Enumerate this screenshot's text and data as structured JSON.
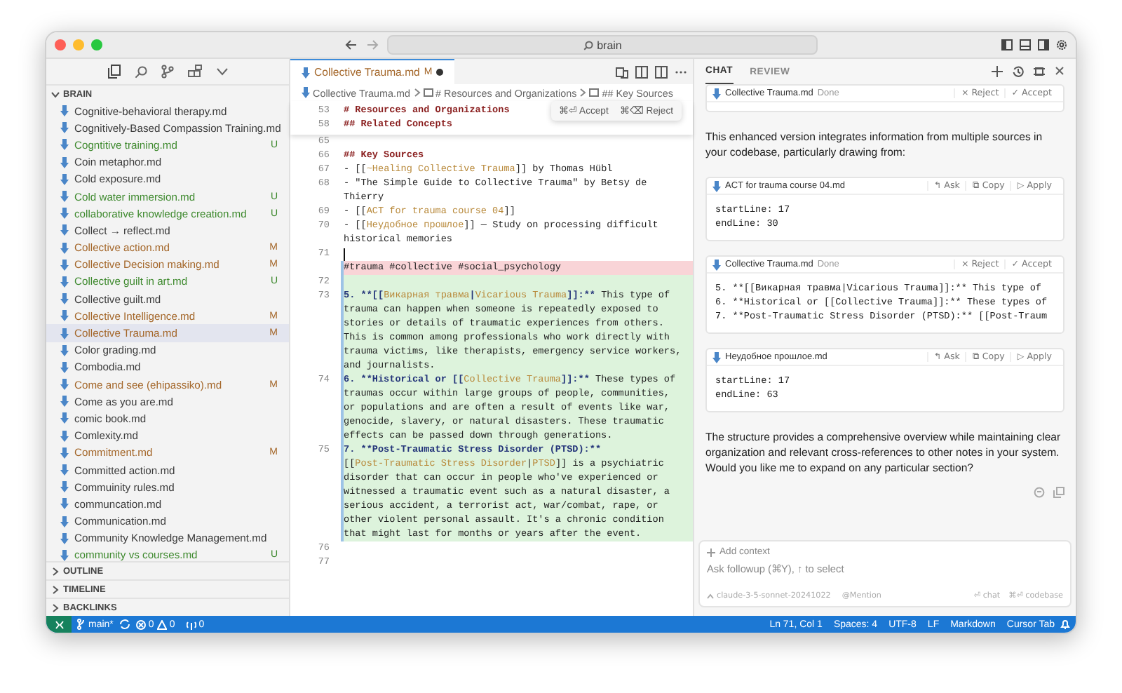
{
  "window": {
    "search": "brain"
  },
  "sidebar": {
    "sections": [
      {
        "title": "BRAIN",
        "expanded": true,
        "files": [
          {
            "name": "Cognitive-behavioral therapy.md",
            "kind": "clean",
            "selected": false
          },
          {
            "name": "Cognitively-Based Compassion Training.md",
            "kind": "clean",
            "selected": false
          },
          {
            "name": "Cogntitive training.md",
            "kind": "untracked",
            "status": "U",
            "selected": false
          },
          {
            "name": "Coin metaphor.md",
            "kind": "clean",
            "selected": false
          },
          {
            "name": "Cold exposure.md",
            "kind": "clean",
            "selected": false
          },
          {
            "name": "Cold water immersion.md",
            "kind": "untracked",
            "status": "U",
            "selected": false
          },
          {
            "name": "collaborative knowledge creation.md",
            "kind": "untracked",
            "status": "U",
            "selected": false
          },
          {
            "name": "Collect → reflect.md",
            "kind": "clean",
            "selected": false
          },
          {
            "name": "Collective action.md",
            "kind": "modified",
            "status": "M",
            "selected": false
          },
          {
            "name": "Collective Decision making.md",
            "kind": "modified",
            "status": "M",
            "selected": false
          },
          {
            "name": "Collective guilt in art.md",
            "kind": "untracked",
            "status": "U",
            "selected": false
          },
          {
            "name": "Collective guilt.md",
            "kind": "clean",
            "selected": false
          },
          {
            "name": "Collective Intelligence.md",
            "kind": "modified",
            "status": "M",
            "selected": false
          },
          {
            "name": "Collective Trauma.md",
            "kind": "modified",
            "status": "M",
            "selected": true
          },
          {
            "name": "Color grading.md",
            "kind": "clean",
            "selected": false
          },
          {
            "name": "Combodia.md",
            "kind": "clean",
            "selected": false
          },
          {
            "name": "Come and see (ehipassiko).md",
            "kind": "modified",
            "status": "M",
            "selected": false
          },
          {
            "name": "Come as you are.md",
            "kind": "clean",
            "selected": false
          },
          {
            "name": "comic book.md",
            "kind": "clean",
            "selected": false
          },
          {
            "name": "Comlexity.md",
            "kind": "clean",
            "selected": false
          },
          {
            "name": "Commitment.md",
            "kind": "modified",
            "status": "M",
            "selected": false
          },
          {
            "name": "Committed action.md",
            "kind": "clean",
            "selected": false
          },
          {
            "name": "Commuinity rules.md",
            "kind": "clean",
            "selected": false
          },
          {
            "name": "communcation.md",
            "kind": "clean",
            "selected": false
          },
          {
            "name": "Communication.md",
            "kind": "clean",
            "selected": false
          },
          {
            "name": "Community Knowledge Management.md",
            "kind": "clean",
            "selected": false
          },
          {
            "name": "community vs courses.md",
            "kind": "untracked",
            "status": "U",
            "selected": false
          }
        ]
      },
      {
        "title": "OUTLINE",
        "expanded": false
      },
      {
        "title": "TIMELINE",
        "expanded": false
      },
      {
        "title": "BACKLINKS",
        "expanded": false
      }
    ]
  },
  "editor": {
    "tab": {
      "title": "Collective Trauma.md",
      "status": "M",
      "dirty": true
    },
    "breadcrumb": [
      "Collective Trauma.md",
      "# Resources and Organizations",
      "## Key Sources"
    ],
    "diff_actions": [
      "⌘⏎ Accept",
      "⌘⌫ Reject"
    ],
    "sticky": [
      {
        "number": "53",
        "rows": [
          [
            {
              "kind": "heading",
              "text": "# Resources and Organizations"
            }
          ]
        ]
      },
      {
        "number": "58",
        "rows": [
          [
            {
              "kind": "heading",
              "text": "## Related Concepts"
            }
          ]
        ]
      }
    ],
    "lines": [
      {
        "number": "65",
        "kind": "unchanged"
      },
      {
        "number": "66",
        "kind": "unchanged",
        "rows": [
          [
            {
              "kind": "heading",
              "text": "## Key Sources"
            }
          ]
        ]
      },
      {
        "number": "67",
        "kind": "unchanged",
        "rows": [
          [
            {
              "kind": "text",
              "text": "- [["
            },
            {
              "kind": "link",
              "text": "~Healing Collective Trauma"
            },
            {
              "kind": "text",
              "text": "]] by Thomas Hübl"
            }
          ]
        ]
      },
      {
        "number": "68",
        "kind": "unchanged",
        "rows": [
          [
            {
              "kind": "text",
              "text": "- \"The Simple Guide to Collective Trauma\" by Betsy de"
            }
          ],
          [
            {
              "kind": "text",
              "text": "Thierry"
            }
          ]
        ]
      },
      {
        "number": "69",
        "kind": "unchanged",
        "rows": [
          [
            {
              "kind": "text",
              "text": "- [["
            },
            {
              "kind": "link",
              "text": "ACT for trauma course 04"
            },
            {
              "kind": "text",
              "text": "]]"
            }
          ]
        ]
      },
      {
        "number": "70",
        "kind": "unchanged",
        "rows": [
          [
            {
              "kind": "text",
              "text": "- [["
            },
            {
              "kind": "link",
              "text": "Неудобное прошлое"
            },
            {
              "kind": "text",
              "text": "]] — Study on processing difficult"
            }
          ],
          [
            {
              "kind": "text",
              "text": "historical memories"
            }
          ]
        ]
      },
      {
        "number": "71",
        "kind": "unchanged",
        "cursor": true
      },
      {
        "kind": "removed",
        "rows": [
          [
            {
              "kind": "text",
              "text": "#trauma #collective #social_psychology"
            }
          ]
        ]
      },
      {
        "number": "72",
        "kind": "added"
      },
      {
        "number": "73",
        "kind": "added",
        "rows": [
          [
            {
              "kind": "bold",
              "text": "5. **[["
            },
            {
              "kind": "link",
              "text": "Викарная травма"
            },
            {
              "kind": "bold",
              "text": "|"
            },
            {
              "kind": "link",
              "text": "Vicarious Trauma"
            },
            {
              "kind": "bold",
              "text": "]]:**"
            },
            {
              "kind": "text",
              "text": " This type of"
            }
          ],
          [
            {
              "kind": "text",
              "text": "trauma can happen when someone is repeatedly exposed to"
            }
          ],
          [
            {
              "kind": "text",
              "text": "stories or details of traumatic experiences from others."
            }
          ],
          [
            {
              "kind": "text",
              "text": "This is common among professionals who work directly with"
            }
          ],
          [
            {
              "kind": "text",
              "text": "trauma victims, like therapists, emergency service workers,"
            }
          ],
          [
            {
              "kind": "text",
              "text": "and journalists."
            }
          ]
        ]
      },
      {
        "number": "74",
        "kind": "added",
        "rows": [
          [
            {
              "kind": "bold",
              "text": "6. **Historical or [["
            },
            {
              "kind": "link",
              "text": "Collective Trauma"
            },
            {
              "kind": "bold",
              "text": "]]:**"
            },
            {
              "kind": "text",
              "text": " These types of"
            }
          ],
          [
            {
              "kind": "text",
              "text": "traumas occur within large groups of people, communities,"
            }
          ],
          [
            {
              "kind": "text",
              "text": "or populations and are often a result of events like war,"
            }
          ],
          [
            {
              "kind": "text",
              "text": "genocide, slavery, or natural disasters. These traumatic"
            }
          ],
          [
            {
              "kind": "text",
              "text": "effects can be passed down through generations."
            }
          ]
        ]
      },
      {
        "number": "75",
        "kind": "added",
        "rows": [
          [
            {
              "kind": "bold",
              "text": "7. **Post-Traumatic Stress Disorder (PTSD):**"
            }
          ],
          [
            {
              "kind": "text",
              "text": "[["
            },
            {
              "kind": "link",
              "text": "Post-Traumatic Stress Disorder"
            },
            {
              "kind": "text",
              "text": "|"
            },
            {
              "kind": "link",
              "text": "PTSD"
            },
            {
              "kind": "text",
              "text": "]] is a psychiatric"
            }
          ],
          [
            {
              "kind": "text",
              "text": "disorder that can occur in people who've experienced or"
            }
          ],
          [
            {
              "kind": "text",
              "text": "witnessed a traumatic event such as a natural disaster, a"
            }
          ],
          [
            {
              "kind": "text",
              "text": "serious accident, a terrorist act, war/combat, rape, or"
            }
          ],
          [
            {
              "kind": "text",
              "text": "other violent personal assault. It's a chronic condition"
            }
          ],
          [
            {
              "kind": "text",
              "text": "that might last for months or years after the event."
            }
          ]
        ]
      },
      {
        "number": "76",
        "kind": "unchanged"
      },
      {
        "number": "77",
        "kind": "unchanged"
      }
    ]
  },
  "chat": {
    "tabs": [
      {
        "label": "CHAT",
        "selected": true
      },
      {
        "label": "REVIEW",
        "selected": false
      }
    ],
    "blocks": [
      {
        "kind": "apply",
        "file": "Collective Trauma.md",
        "state": "Done",
        "actions": [
          "× Reject",
          "✓ Accept"
        ]
      },
      {
        "kind": "text",
        "text": "This enhanced version integrates information from multiple sources in your codebase, particularly drawing from:"
      },
      {
        "kind": "code",
        "file": "ACT for trauma course 04.md",
        "actions": [
          "↰ Ask",
          "⧉ Copy",
          "▷ Apply"
        ],
        "lines": [
          "startLine: 17",
          "endLine: 30"
        ]
      },
      {
        "kind": "apply",
        "file": "Collective Trauma.md",
        "state": "Done",
        "actions": [
          "× Reject",
          "✓ Accept"
        ],
        "lines": [
          "5. **[[Викарная травма|Vicarious Trauma]]:** This type of",
          "6. **Historical or [[Collective Trauma]]:** These types of",
          "7. **Post-Traumatic Stress Disorder (PTSD):** [[Post-Traum"
        ]
      },
      {
        "kind": "code",
        "file": "Неудобное прошлое.md",
        "actions": [
          "↰ Ask",
          "⧉ Copy",
          "▷ Apply"
        ],
        "lines": [
          "startLine: 17",
          "endLine: 63"
        ]
      },
      {
        "kind": "text",
        "text": "The structure provides a comprehensive overview while maintaining clear organization and relevant cross-references to other notes in your system. Would you like me to expand on any particular section?"
      }
    ],
    "input": {
      "add_context": "Add context",
      "placeholder": "Ask followup (⌘Y), ↑ to select",
      "model": "claude-3-5-sonnet-20241022",
      "mention": "@Mention",
      "actions": [
        "⏎ chat",
        "⌘⏎ codebase"
      ]
    }
  },
  "status_bar": {
    "branch": "main*",
    "errors": "0",
    "warnings": "0",
    "ports": "0",
    "items": [
      "Ln 71, Col 1",
      "Spaces: 4",
      "UTF-8",
      "LF",
      "Markdown",
      "Cursor Tab"
    ]
  }
}
